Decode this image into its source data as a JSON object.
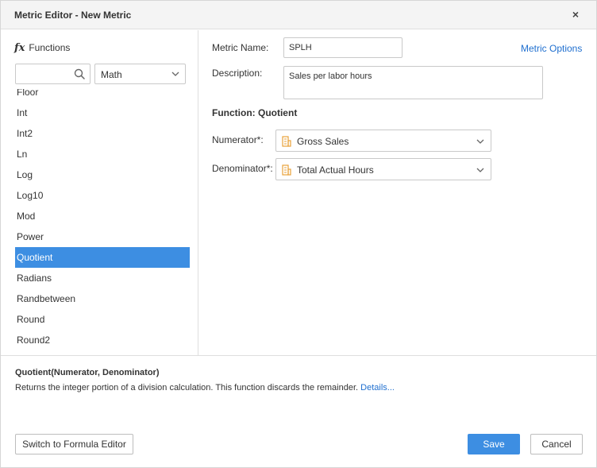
{
  "window": {
    "title": "Metric Editor - New Metric",
    "close_glyph": "×"
  },
  "sidebar": {
    "header_icon": "fx",
    "header_label": "Functions",
    "search": {
      "value": "",
      "placeholder": ""
    },
    "category": {
      "selected": "Math"
    },
    "functions": [
      {
        "label": "Floor",
        "selected": false
      },
      {
        "label": "Int",
        "selected": false
      },
      {
        "label": "Int2",
        "selected": false
      },
      {
        "label": "Ln",
        "selected": false
      },
      {
        "label": "Log",
        "selected": false
      },
      {
        "label": "Log10",
        "selected": false
      },
      {
        "label": "Mod",
        "selected": false
      },
      {
        "label": "Power",
        "selected": false
      },
      {
        "label": "Quotient",
        "selected": true
      },
      {
        "label": "Radians",
        "selected": false
      },
      {
        "label": "Randbetween",
        "selected": false
      },
      {
        "label": "Round",
        "selected": false
      },
      {
        "label": "Round2",
        "selected": false
      }
    ]
  },
  "main": {
    "metric_name_label": "Metric Name:",
    "metric_name_value": "SPLH",
    "metric_options_link": "Metric Options",
    "description_label": "Description:",
    "description_value": "Sales per labor hours",
    "function_title": "Function: Quotient",
    "numerator_label": "Numerator*:",
    "numerator_value": "Gross Sales",
    "denominator_label": "Denominator*:",
    "denominator_value": "Total Actual Hours"
  },
  "help": {
    "signature": "Quotient(Numerator, Denominator)",
    "description": "Returns the integer portion of a division calculation. This function discards the remainder.",
    "details_link": "Details..."
  },
  "footer": {
    "switch_button": "Switch to Formula Editor",
    "save_button": "Save",
    "cancel_button": "Cancel"
  },
  "colors": {
    "accent": "#3d8ee2",
    "link": "#1f6fcf",
    "field_icon": "#e8a23a"
  }
}
